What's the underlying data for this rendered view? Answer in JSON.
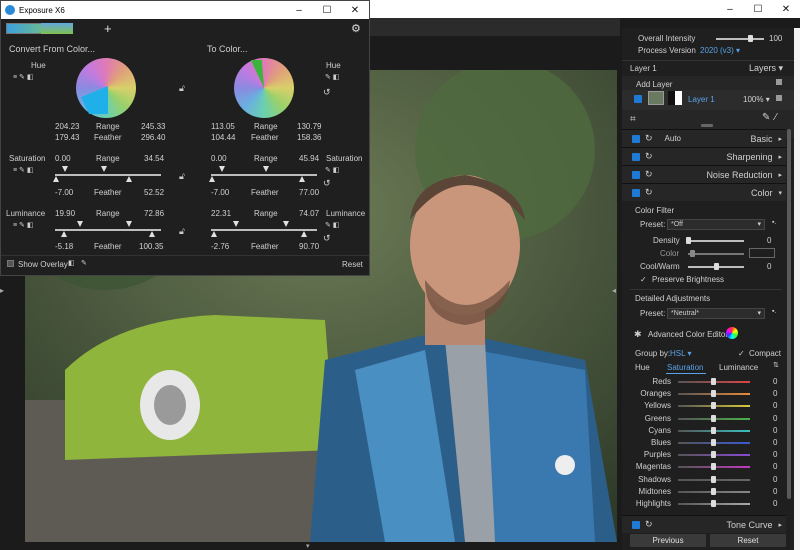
{
  "window": {
    "title": "Exposure X6"
  },
  "floating_panel": {
    "from_title": "Convert From Color...",
    "to_title": "To Color...",
    "hue_label": "Hue",
    "from_hue": {
      "v1": "204.23",
      "range_label": "Range",
      "v2": "245.33",
      "v3": "179.43",
      "feather_label": "Feather",
      "v4": "296.40"
    },
    "to_hue": {
      "v1": "113.05",
      "range_label": "Range",
      "v2": "130.79",
      "v3": "104.44",
      "feather_label": "Feather",
      "v4": "158.36"
    },
    "saturation_label": "Saturation",
    "from_sat": {
      "v1": "0.00",
      "range_label": "Range",
      "v2": "34.54",
      "v3": "-7.00",
      "feather_label": "Feather",
      "v4": "52.52"
    },
    "to_sat": {
      "v1": "0.00",
      "range_label": "Range",
      "v2": "45.94",
      "v3": "-7.00",
      "feather_label": "Feather",
      "v4": "77.00"
    },
    "luminance_label": "Luminance",
    "from_lum": {
      "v1": "19.90",
      "range_label": "Range",
      "v2": "72.86",
      "v3": "-5.18",
      "feather_label": "Feather",
      "v4": "100.35"
    },
    "to_lum": {
      "v1": "22.31",
      "range_label": "Range",
      "v2": "74.07",
      "v3": "-2.76",
      "feather_label": "Feather",
      "v4": "90.70"
    },
    "show_overlay": "Show Overlay",
    "reset": "Reset"
  },
  "right_panel": {
    "overall_intensity_label": "Overall Intensity",
    "overall_intensity_value": "100",
    "process_version_label": "Process Version",
    "process_version_value": "2020 (v3)",
    "layer_header": "Layer 1",
    "layers_label": "Layers",
    "add_layer": "Add Layer",
    "layer_name": "Layer 1",
    "layer_opacity": "100%",
    "basic": {
      "auto": "Auto",
      "label": "Basic"
    },
    "sections": [
      "Sharpening",
      "Noise Reduction",
      "Color"
    ],
    "color_filter": {
      "title": "Color Filter",
      "preset_label": "Preset:",
      "preset_value": "*Off",
      "density_label": "Density",
      "density_value": "0",
      "color_label": "Color",
      "coolwarm_label": "Cool/Warm",
      "coolwarm_value": "0",
      "preserve": "Preserve Brightness"
    },
    "detailed": {
      "title": "Detailed Adjustments",
      "preset_label": "Preset:",
      "preset_value": "*Neutral*",
      "ace": "Advanced Color Editor",
      "group_label": "Group by:",
      "group_value": "HSL",
      "compact": "Compact",
      "tabs": [
        "Hue",
        "Saturation",
        "Luminance"
      ],
      "rows": [
        {
          "name": "Reds",
          "value": "0"
        },
        {
          "name": "Oranges",
          "value": "0"
        },
        {
          "name": "Yellows",
          "value": "0"
        },
        {
          "name": "Greens",
          "value": "0"
        },
        {
          "name": "Cyans",
          "value": "0"
        },
        {
          "name": "Blues",
          "value": "0"
        },
        {
          "name": "Purples",
          "value": "0"
        },
        {
          "name": "Magentas",
          "value": "0"
        },
        {
          "name": "Shadows",
          "value": "0"
        },
        {
          "name": "Midtones",
          "value": "0"
        },
        {
          "name": "Highlights",
          "value": "0"
        }
      ]
    },
    "tone_curve": "Tone Curve",
    "previous": "Previous",
    "reset": "Reset"
  },
  "colors": {
    "accent": "#1f7ad6",
    "panel": "#1f1f1f"
  }
}
